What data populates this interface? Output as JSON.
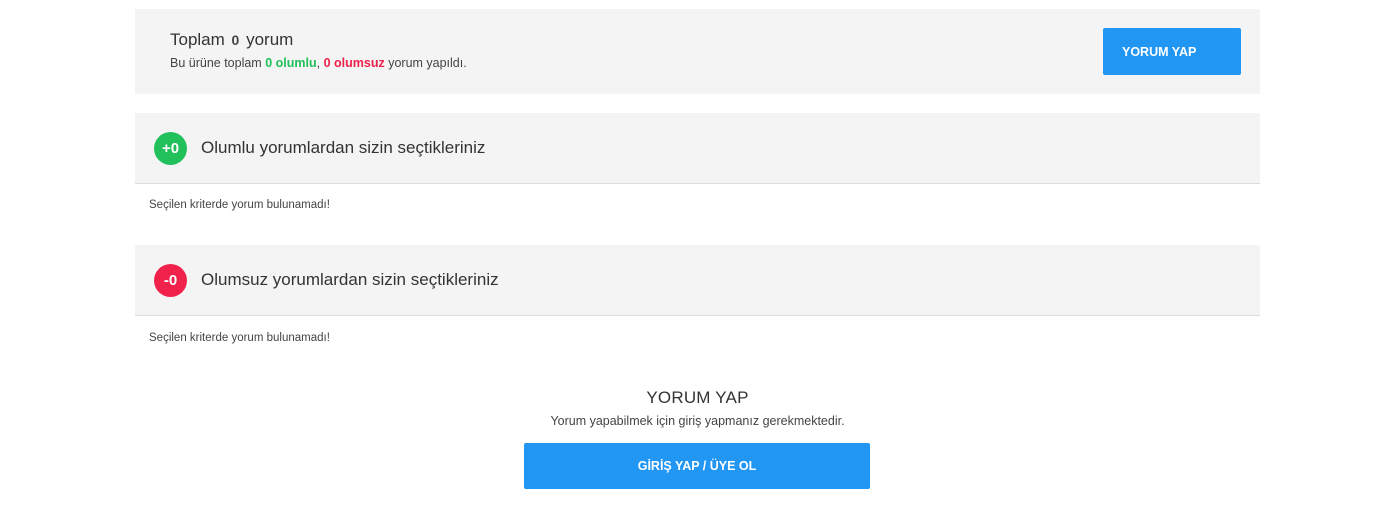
{
  "summary": {
    "title_prefix": "Toplam",
    "total_count": "0",
    "title_suffix": "yorum",
    "text_prefix": "Bu ürüne toplam",
    "positive_text": "0 olumlu",
    "separator": ",",
    "negative_text": "0 olumsuz",
    "text_suffix": "yorum yapıldı.",
    "button_label": "YORUM YAP"
  },
  "positive_section": {
    "badge": "+0",
    "title": "Olumlu yorumlardan sizin seçtikleriniz",
    "empty_message": "Seçilen kriterde yorum bulunamadı!"
  },
  "negative_section": {
    "badge": "-0",
    "title": "Olumsuz yorumlardan sizin seçtikleriniz",
    "empty_message": "Seçilen kriterde yorum bulunamadı!"
  },
  "cta": {
    "title": "YORUM YAP",
    "text": "Yorum yapabilmek için giriş yapmanız gerekmektedir.",
    "button_label": "GİRİŞ YAP / ÜYE OL"
  },
  "colors": {
    "accent": "#2196f3",
    "positive": "#22c05a",
    "negative": "#f0214b",
    "panel_bg": "#f4f4f4"
  }
}
